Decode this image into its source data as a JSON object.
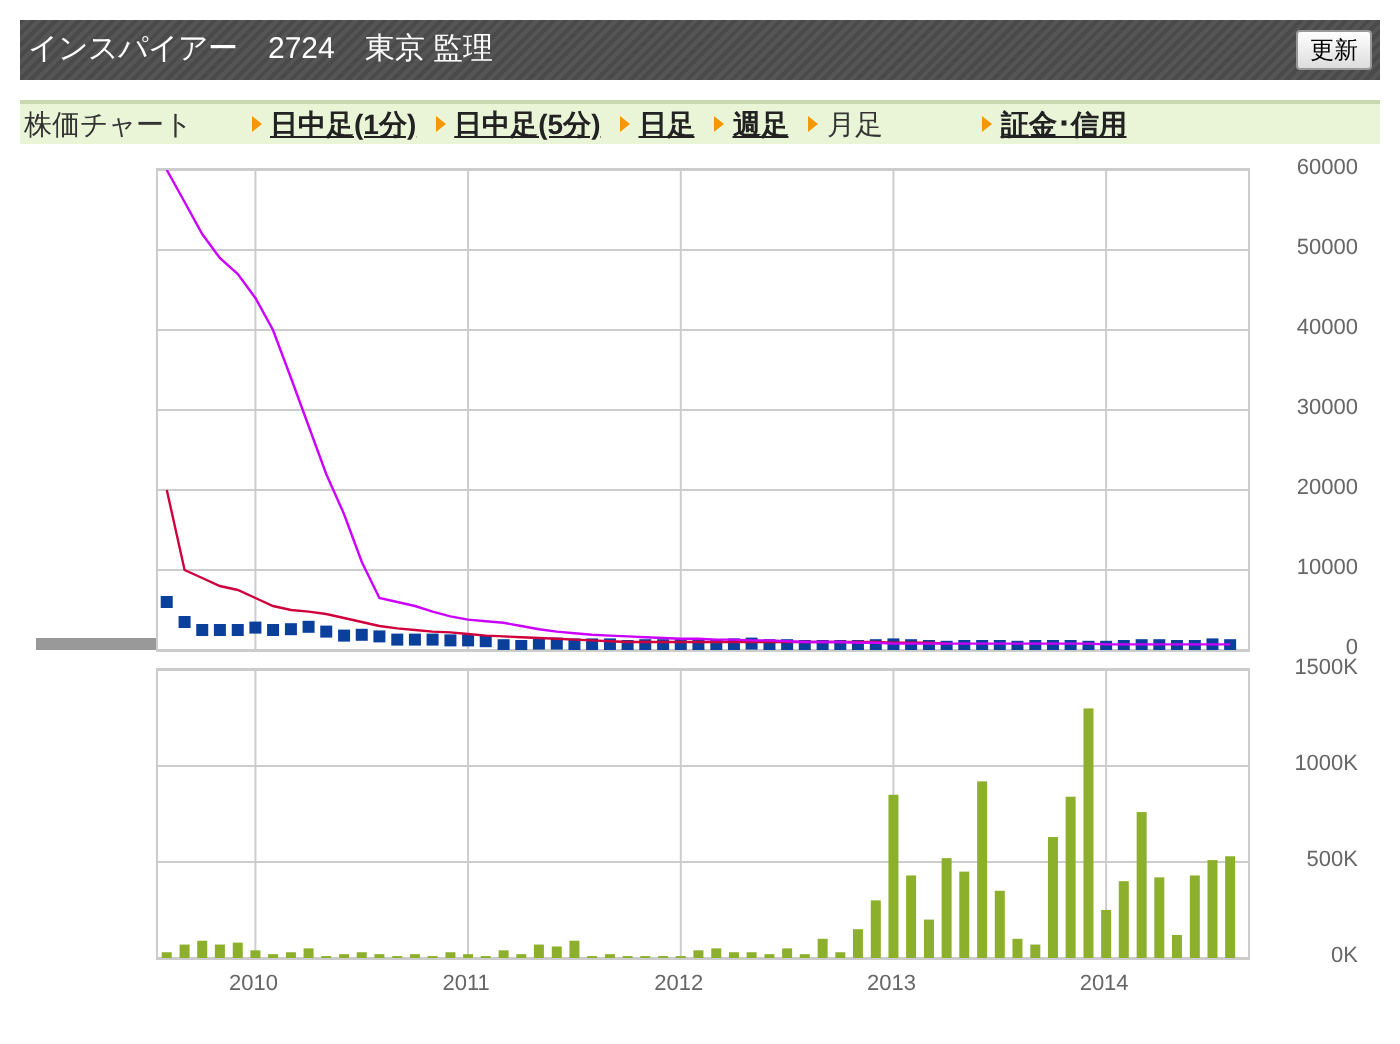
{
  "header": {
    "title": "インスパイアー　2724　東京 監理",
    "refresh_button": "更新"
  },
  "nav": {
    "label": "株価チャート",
    "links": [
      {
        "text": "日中足(1分)",
        "selected": false
      },
      {
        "text": "日中足(5分)",
        "selected": false
      },
      {
        "text": "日足",
        "selected": false
      },
      {
        "text": "週足",
        "selected": false
      },
      {
        "text": "月足",
        "selected": true
      },
      {
        "text": "証金･信用",
        "selected": false
      }
    ]
  },
  "price_chart": {
    "chart_data": {
      "type": "line",
      "x": [
        2009.583,
        2009.667,
        2009.75,
        2009.833,
        2009.917,
        2010,
        2010.083,
        2010.167,
        2010.25,
        2010.333,
        2010.417,
        2010.5,
        2010.583,
        2010.667,
        2010.75,
        2010.833,
        2010.917,
        2011,
        2011.083,
        2011.167,
        2011.25,
        2011.333,
        2011.417,
        2011.5,
        2011.583,
        2011.667,
        2011.75,
        2011.833,
        2011.917,
        2012,
        2012.083,
        2012.167,
        2012.25,
        2012.333,
        2012.417,
        2012.5,
        2012.583,
        2012.667,
        2012.75,
        2012.833,
        2012.917,
        2013,
        2013.083,
        2013.167,
        2013.25,
        2013.333,
        2013.417,
        2013.5,
        2013.583,
        2013.667,
        2013.75,
        2013.833,
        2013.917,
        2014,
        2014.083,
        2014.167,
        2014.25,
        2014.333,
        2014.417,
        2014.5,
        2014.583
      ],
      "xlim": [
        2009.542,
        2014.667
      ],
      "ylim": [
        0,
        60000
      ],
      "grid": true,
      "yticks": [
        {
          "value": 0,
          "label": "0"
        },
        {
          "value": 10000,
          "label": "10000"
        },
        {
          "value": 20000,
          "label": "20000"
        },
        {
          "value": 30000,
          "label": "30000"
        },
        {
          "value": 40000,
          "label": "40000"
        },
        {
          "value": 50000,
          "label": "50000"
        },
        {
          "value": 60000,
          "label": "60000"
        }
      ],
      "series": [
        {
          "type": "scatter",
          "color": "#0b3f9c",
          "values": [
            6000,
            3500,
            2500,
            2500,
            2500,
            2800,
            2500,
            2600,
            2900,
            2300,
            1800,
            1900,
            1700,
            1300,
            1300,
            1300,
            1200,
            1200,
            1100,
            600,
            500,
            800,
            800,
            700,
            700,
            700,
            500,
            600,
            600,
            600,
            500,
            600,
            700,
            800,
            600,
            600,
            500,
            500,
            500,
            500,
            600,
            700,
            600,
            500,
            400,
            500,
            500,
            500,
            400,
            500,
            500,
            500,
            400,
            400,
            500,
            600,
            600,
            500,
            500,
            700,
            600
          ]
        },
        {
          "type": "line",
          "color": "#d0003c",
          "values": [
            20000,
            10000,
            9000,
            8000,
            7500,
            6500,
            5500,
            5000,
            4800,
            4500,
            4000,
            3500,
            3000,
            2700,
            2500,
            2300,
            2200,
            2000,
            1800,
            1700,
            1600,
            1500,
            1400,
            1300,
            1200,
            1100,
            1000,
            1000,
            1000,
            1000,
            1000,
            1000,
            1000,
            1000,
            1000,
            1000,
            1000,
            1000,
            1000,
            1000,
            1000,
            900,
            900,
            900,
            800,
            null,
            null,
            null,
            null,
            null,
            null,
            null,
            null,
            null,
            null,
            null,
            null,
            null,
            null,
            null,
            null
          ]
        },
        {
          "type": "line",
          "color": "#cc00ff",
          "values": [
            60000,
            56000,
            52000,
            49000,
            47000,
            44000,
            40000,
            34000,
            28000,
            22000,
            17000,
            11000,
            6500,
            6000,
            5500,
            4800,
            4200,
            3800,
            3600,
            3400,
            3000,
            2600,
            2300,
            2100,
            1900,
            1800,
            1700,
            1600,
            1500,
            1400,
            1400,
            1300,
            1300,
            1200,
            1200,
            1100,
            1000,
            1000,
            1000,
            900,
            900,
            800,
            800,
            800,
            800,
            800,
            800,
            800,
            800,
            800,
            800,
            800,
            800,
            700,
            700,
            700,
            700,
            700,
            700,
            700,
            700
          ]
        }
      ]
    }
  },
  "volume_chart": {
    "chart_data": {
      "type": "bar",
      "x": [
        2009.583,
        2009.667,
        2009.75,
        2009.833,
        2009.917,
        2010,
        2010.083,
        2010.167,
        2010.25,
        2010.333,
        2010.417,
        2010.5,
        2010.583,
        2010.667,
        2010.75,
        2010.833,
        2010.917,
        2011,
        2011.083,
        2011.167,
        2011.25,
        2011.333,
        2011.417,
        2011.5,
        2011.583,
        2011.667,
        2011.75,
        2011.833,
        2011.917,
        2012,
        2012.083,
        2012.167,
        2012.25,
        2012.333,
        2012.417,
        2012.5,
        2012.583,
        2012.667,
        2012.75,
        2012.833,
        2012.917,
        2013,
        2013.083,
        2013.167,
        2013.25,
        2013.333,
        2013.417,
        2013.5,
        2013.583,
        2013.667,
        2013.75,
        2013.833,
        2013.917,
        2014,
        2014.083,
        2014.167,
        2014.25,
        2014.333,
        2014.417,
        2014.5,
        2014.583
      ],
      "xlim": [
        2009.542,
        2014.667
      ],
      "ylim": [
        0,
        1500
      ],
      "grid": true,
      "yticks": [
        {
          "value": 0,
          "label": "0K"
        },
        {
          "value": 500,
          "label": "500K"
        },
        {
          "value": 1000,
          "label": "1000K"
        },
        {
          "value": 1500,
          "label": "1500K"
        }
      ],
      "xticks": [
        {
          "value": 2010,
          "label": "2010"
        },
        {
          "value": 2011,
          "label": "2011"
        },
        {
          "value": 2012,
          "label": "2012"
        },
        {
          "value": 2013,
          "label": "2013"
        },
        {
          "value": 2014,
          "label": "2014"
        }
      ],
      "series": [
        {
          "color": "#8db02c",
          "values": [
            30,
            70,
            90,
            70,
            80,
            40,
            20,
            30,
            50,
            10,
            20,
            30,
            20,
            10,
            20,
            10,
            30,
            20,
            10,
            40,
            20,
            70,
            60,
            90,
            10,
            20,
            10,
            10,
            10,
            10,
            40,
            50,
            30,
            30,
            20,
            50,
            20,
            100,
            30,
            150,
            300,
            850,
            430,
            200,
            520,
            450,
            920,
            350,
            100,
            70,
            630,
            840,
            1300,
            250,
            400,
            760,
            420,
            120,
            430,
            510,
            530
          ]
        }
      ]
    }
  }
}
